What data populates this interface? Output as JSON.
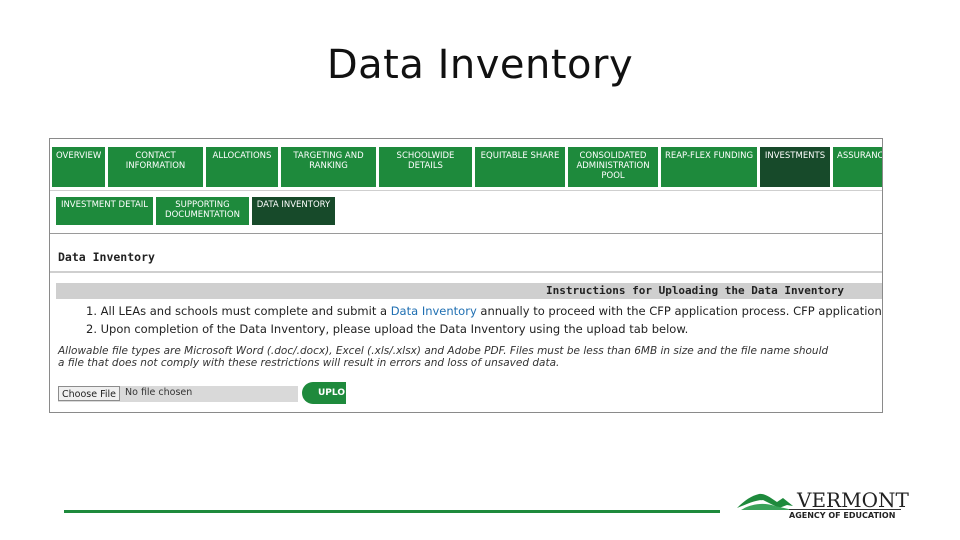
{
  "slide": {
    "title": "Data Inventory"
  },
  "app": {
    "top_tabs": [
      {
        "label": "OVERVIEW",
        "active": false
      },
      {
        "label": "CONTACT INFORMATION",
        "active": false
      },
      {
        "label": "ALLOCATIONS",
        "active": false
      },
      {
        "label": "TARGETING AND RANKING",
        "active": false
      },
      {
        "label": "SCHOOLWIDE DETAILS",
        "active": false
      },
      {
        "label": "EQUITABLE SHARE",
        "active": false
      },
      {
        "label": "CONSOLIDATED ADMINISTRATION POOL",
        "active": false
      },
      {
        "label": "REAP-FLEX FUNDING",
        "active": false
      },
      {
        "label": "INVESTMENTS",
        "active": true
      },
      {
        "label": "ASSURANC",
        "active": false
      }
    ],
    "sub_tabs": [
      {
        "label": "INVESTMENT DETAIL",
        "active": false
      },
      {
        "label": "SUPPORTING DOCUMENTATION",
        "active": false
      },
      {
        "label": "DATA INVENTORY",
        "active": true
      }
    ],
    "section_title": "Data Inventory",
    "instructions_title": "Instructions for Uploading the Data Inventory",
    "instructions": [
      {
        "prefix": "1. All LEAs and schools must complete and submit a ",
        "link": "Data Inventory",
        "suffix": " annually to proceed with the CFP application process. CFP applications will"
      },
      {
        "prefix": "2. Upon completion of the Data Inventory, please upload the Data Inventory using the upload tab below.",
        "link": "",
        "suffix": ""
      }
    ],
    "note_line1": "Allowable file types are Microsoft Word (.doc/.docx), Excel (.xls/.xlsx) and Adobe PDF. Files must be less than 6MB in size and the file name should",
    "note_line2": "a file that does not comply with these restrictions will result in errors and loss of unsaved data.",
    "file_input": {
      "button_label": "Choose File",
      "status": "No file chosen"
    },
    "upload_button": "UPLO"
  },
  "logo": {
    "name": "VERMONT",
    "subtitle": "AGENCY OF EDUCATION"
  },
  "colors": {
    "accent": "#1e8a3c",
    "active_tab": "#174a2a",
    "link": "#1f6fb2"
  }
}
